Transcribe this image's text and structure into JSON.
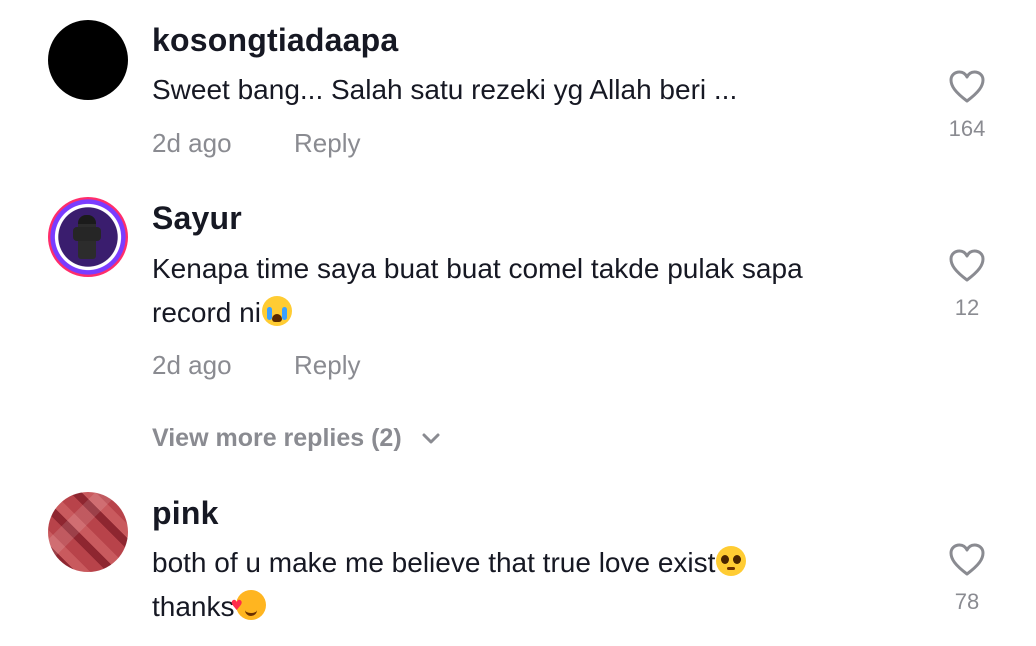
{
  "comments": [
    {
      "username": "kosongtiadaapa",
      "text": "Sweet bang... Salah satu rezeki yg Allah beri ...",
      "time": "2d ago",
      "reply_label": "Reply",
      "likes": "164",
      "avatar": "black-avatar"
    },
    {
      "username": "Sayur",
      "text_line1": "Kenapa time saya buat buat comel takde pulak sapa",
      "text_line2": "record ni",
      "emoji": "loudly-crying-face",
      "time": "2d ago",
      "reply_label": "Reply",
      "likes": "12",
      "view_more": "View more replies (2)"
    },
    {
      "username": "pink",
      "text_line1": "both of u make me believe that true love exist",
      "emoji1": "pleading-face",
      "text_line2": "thanks",
      "emoji2": "smiling-face-with-hearts",
      "likes": "78"
    }
  ],
  "colors": {
    "primary_text": "#161823",
    "secondary_text": "#8a8b91",
    "background": "#ffffff"
  },
  "icons": {
    "like": "heart-outline-icon",
    "expand": "chevron-down-icon"
  }
}
